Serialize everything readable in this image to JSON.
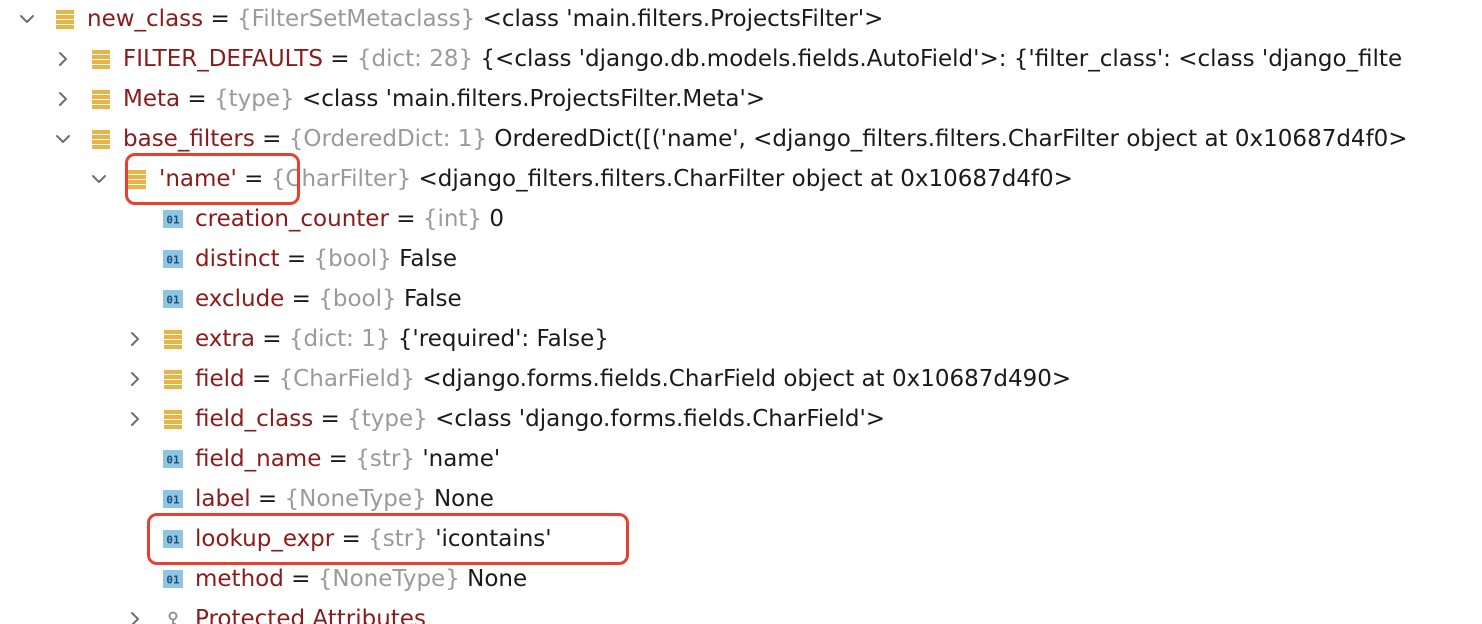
{
  "rows": [
    {
      "icon": "list-icon",
      "expander": "expanded",
      "name": "new_class",
      "type": "{FilterSetMetaclass}",
      "value": "<class 'main.filters.ProjectsFilter'>"
    },
    {
      "icon": "list-icon",
      "expander": "collapsed",
      "name": "FILTER_DEFAULTS",
      "type": "{dict: 28}",
      "value": "{<class 'django.db.models.fields.AutoField'>: {'filter_class': <class 'django_filte"
    },
    {
      "icon": "list-icon",
      "expander": "collapsed",
      "name": "Meta",
      "type": "{type}",
      "value": "<class 'main.filters.ProjectsFilter.Meta'>"
    },
    {
      "icon": "list-icon",
      "expander": "expanded",
      "name": "base_filters",
      "type": "{OrderedDict: 1}",
      "value": "OrderedDict([('name', <django_filters.filters.CharFilter object at 0x10687d4f0>"
    },
    {
      "icon": "list-icon",
      "expander": "expanded",
      "name": "'name'",
      "type": "{CharFilter}",
      "value": "<django_filters.filters.CharFilter object at 0x10687d4f0>"
    },
    {
      "icon": "primitive-icon",
      "expander": "none",
      "name": "creation_counter",
      "type": "{int}",
      "value": "0"
    },
    {
      "icon": "primitive-icon",
      "expander": "none",
      "name": "distinct",
      "type": "{bool}",
      "value": "False"
    },
    {
      "icon": "primitive-icon",
      "expander": "none",
      "name": "exclude",
      "type": "{bool}",
      "value": "False"
    },
    {
      "icon": "list-icon",
      "expander": "collapsed",
      "name": "extra",
      "type": "{dict: 1}",
      "value": "{'required': False}"
    },
    {
      "icon": "list-icon",
      "expander": "collapsed",
      "name": "field",
      "type": "{CharField}",
      "value": "<django.forms.fields.CharField object at 0x10687d490>"
    },
    {
      "icon": "list-icon",
      "expander": "collapsed",
      "name": "field_class",
      "type": "{type}",
      "value": "<class 'django.forms.fields.CharField'>"
    },
    {
      "icon": "primitive-icon",
      "expander": "none",
      "name": "field_name",
      "type": "{str}",
      "value": "'name'"
    },
    {
      "icon": "primitive-icon",
      "expander": "none",
      "name": "label",
      "type": "{NoneType}",
      "value": "None"
    },
    {
      "icon": "primitive-icon",
      "expander": "none",
      "name": "lookup_expr",
      "type": "{str}",
      "value": "'icontains'"
    },
    {
      "icon": "primitive-icon",
      "expander": "none",
      "name": "method",
      "type": "{NoneType}",
      "value": "None"
    },
    {
      "icon": "protected-icon",
      "expander": "collapsed",
      "name": "Protected Attributes",
      "type": "",
      "value": ""
    }
  ],
  "icon_glyphs": {
    "primitive_label": "01"
  },
  "colors": {
    "name": "#8b1a1a",
    "type": "#9a9a9a",
    "value": "#1a1a1a",
    "list_icon": "#e8b445",
    "primitive_icon_bg": "#8fc4e3",
    "highlight_border": "#e8402f"
  }
}
